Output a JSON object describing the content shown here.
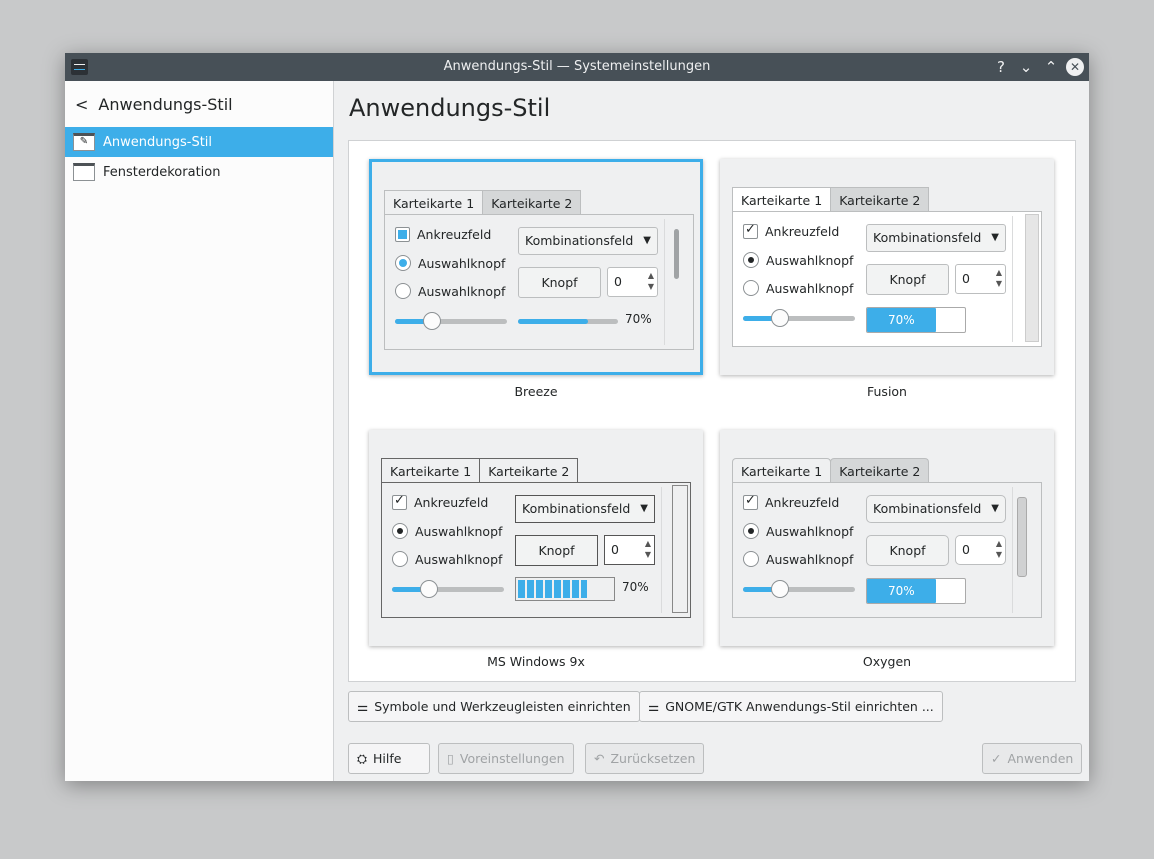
{
  "window": {
    "title": "Anwendungs-Stil — Systemeinstellungen",
    "buttons": {
      "help": "?",
      "minimize": "⌄",
      "maximize": "⌃",
      "close": "✕"
    }
  },
  "sidebar": {
    "back_title": "Anwendungs-Stil",
    "items": [
      {
        "label": "Anwendungs-Stil",
        "selected": true
      },
      {
        "label": "Fensterdekoration",
        "selected": false
      }
    ]
  },
  "main": {
    "title": "Anwendungs-Stil"
  },
  "preview": {
    "tab1": "Karteikarte 1",
    "tab2": "Karteikarte 2",
    "checkbox": "Ankreuzfeld",
    "radio": "Auswahlknopf",
    "combo": "Kombinationsfeld",
    "button": "Knopf",
    "spin_value": "0",
    "progress_label": "70%",
    "progress": 0.7
  },
  "styles": [
    {
      "name": "Breeze",
      "selected": true
    },
    {
      "name": "Fusion"
    },
    {
      "name": "MS Windows 9x"
    },
    {
      "name": "Oxygen"
    }
  ],
  "buttons": {
    "icons": "Symbole und Werkzeugleisten einrichten",
    "gtk": "GNOME/GTK Anwendungs-Stil einrichten ...",
    "help": "Hilfe",
    "defaults": "Voreinstellungen",
    "reset": "Zurücksetzen",
    "apply": "Anwenden"
  },
  "colors": {
    "accent": "#3daee9",
    "titlebar": "#475057"
  }
}
